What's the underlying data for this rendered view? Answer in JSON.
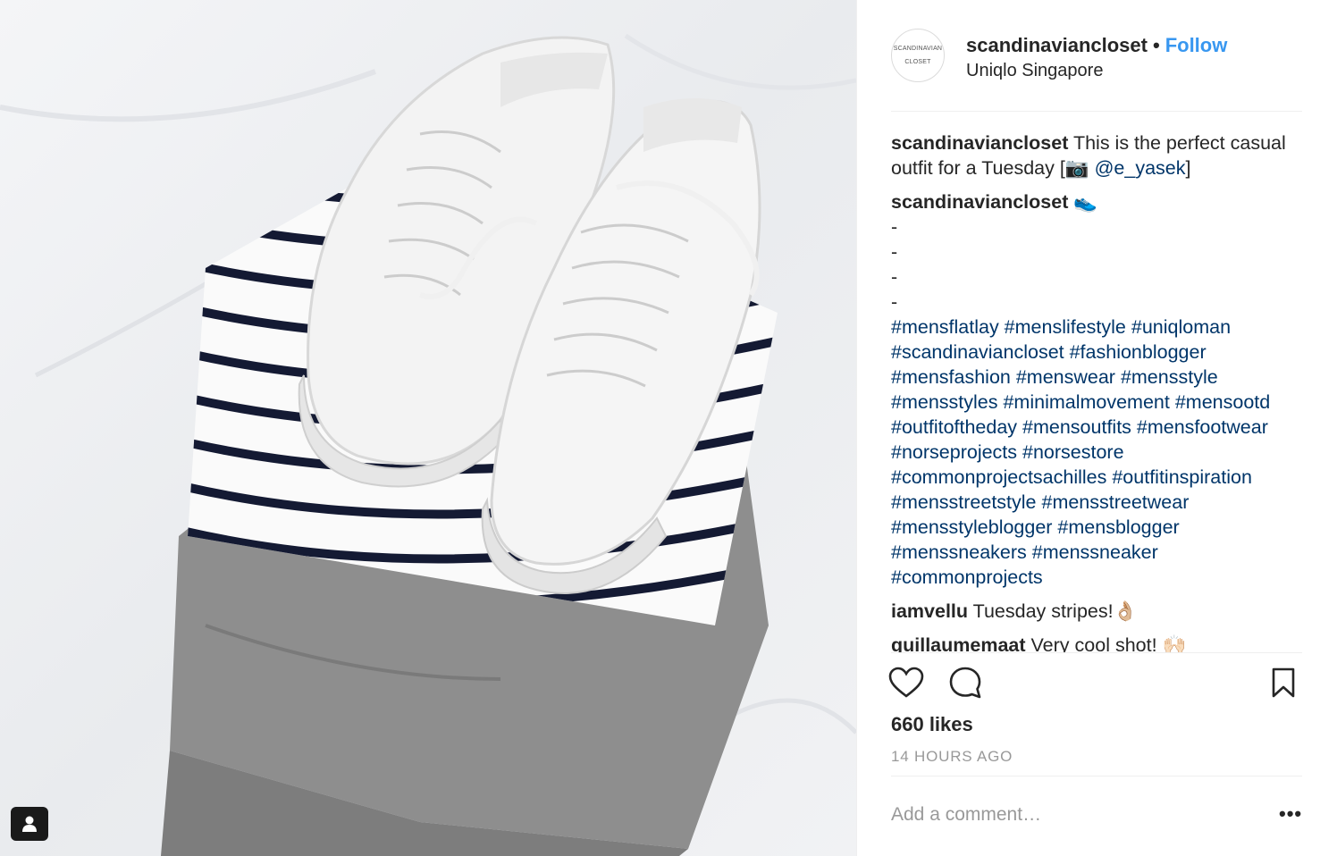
{
  "post": {
    "avatar_text_line1": "SCANDINAVIAN",
    "avatar_text_line2": "CLOSET",
    "username": "scandinaviancloset",
    "separator": "•",
    "follow_label": "Follow",
    "location": "Uniqlo Singapore"
  },
  "caption": {
    "user": "scandinaviancloset",
    "text_before_mention": "This is the perfect casual outfit for a Tuesday [",
    "camera_emoji": "📷",
    "mention": "@e_yasek",
    "text_after_mention": "]"
  },
  "comments": [
    {
      "user": "scandinaviancloset",
      "emoji": "👟",
      "dashes": "-\n-\n-\n-",
      "hashtags": "#mensflatlay #menslifestyle #uniqloman #scandinaviancloset #fashionblogger #mensfashion #menswear #mensstyle #mensstyles #minimalmovement #mensootd #outfitoftheday #mensoutfits #mensfootwear #norseprojects #norsestore #commonprojectsachilles #outfitinspiration #mensstreetstyle #mensstreetwear #mensstyleblogger #mensblogger #menssneakers #menssneaker #commonprojects"
    },
    {
      "user": "iamvellu",
      "text": "Tuesday stripes!",
      "emoji": "👌🏼"
    },
    {
      "user": "guillaumemaat",
      "text": "Very cool shot!",
      "emoji": "🙌🏻"
    }
  ],
  "actions": {
    "like_icon": "heart-icon",
    "comment_icon": "comment-bubble-icon",
    "save_icon": "bookmark-icon"
  },
  "likes": "660 likes",
  "time_ago": "14 HOURS AGO",
  "add_comment_placeholder": "Add a comment…",
  "more_options": "•••",
  "colors": {
    "link_blue": "#003569",
    "follow_blue": "#3897f0",
    "text_dark": "#262626",
    "muted_gray": "#999999"
  }
}
